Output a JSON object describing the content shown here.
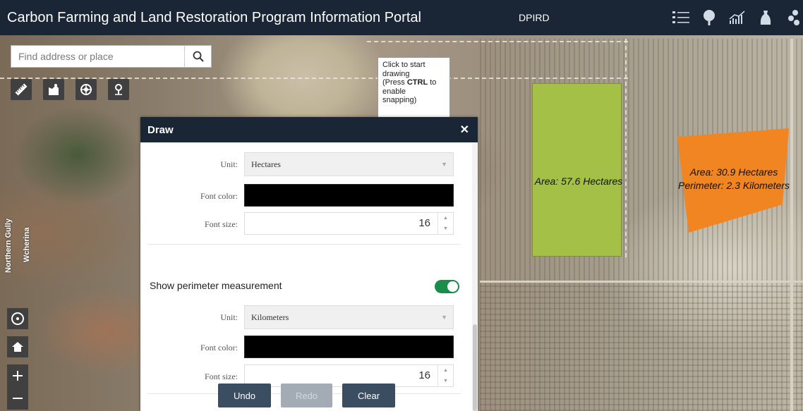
{
  "header": {
    "title": "Carbon Farming and Land Restoration Program Information Portal",
    "org": "DPIRD",
    "tools": [
      {
        "icon": "list-icon"
      },
      {
        "icon": "tree-icon"
      },
      {
        "icon": "chart-icon"
      },
      {
        "icon": "bag-icon"
      },
      {
        "icon": "layers-icon"
      }
    ]
  },
  "search": {
    "placeholder": "Find address or place",
    "value": ""
  },
  "map_tools": [
    {
      "icon": "ruler-icon"
    },
    {
      "icon": "draw-icon"
    },
    {
      "icon": "bookmark-icon"
    },
    {
      "icon": "locate-icon"
    }
  ],
  "tooltip": {
    "line1": "Click to start",
    "line2": "drawing",
    "line3_pre": "(Press ",
    "line3_key": "CTRL",
    "line3_post": " to",
    "line4": "enable",
    "line5": "snapping)"
  },
  "map_labels": {
    "road1": "Northern Gully",
    "road2": "Wcherina",
    "green_area": "Area: 57.6 Hectares",
    "orange_area": "Area: 30.9 Hectares",
    "orange_perimeter": "Perimeter: 2.3 Kilometers"
  },
  "polygon_colors": {
    "green": "#a4c046",
    "orange": "#f08522"
  },
  "panel": {
    "title": "Draw",
    "area_unit_label": "Unit:",
    "area_unit_value": "Hectares",
    "area_font_color_label": "Font color:",
    "area_font_color": "#000000",
    "area_font_size_label": "Font size:",
    "area_font_size": "16",
    "perimeter_toggle_label": "Show perimeter measurement",
    "perimeter_toggle_on": true,
    "perimeter_unit_label": "Unit:",
    "perimeter_unit_value": "Kilometers",
    "perimeter_font_color_label": "Font color:",
    "perimeter_font_color": "#000000",
    "perimeter_font_size_label": "Font size:",
    "perimeter_font_size": "16",
    "undo": "Undo",
    "redo": "Redo",
    "clear": "Clear"
  }
}
